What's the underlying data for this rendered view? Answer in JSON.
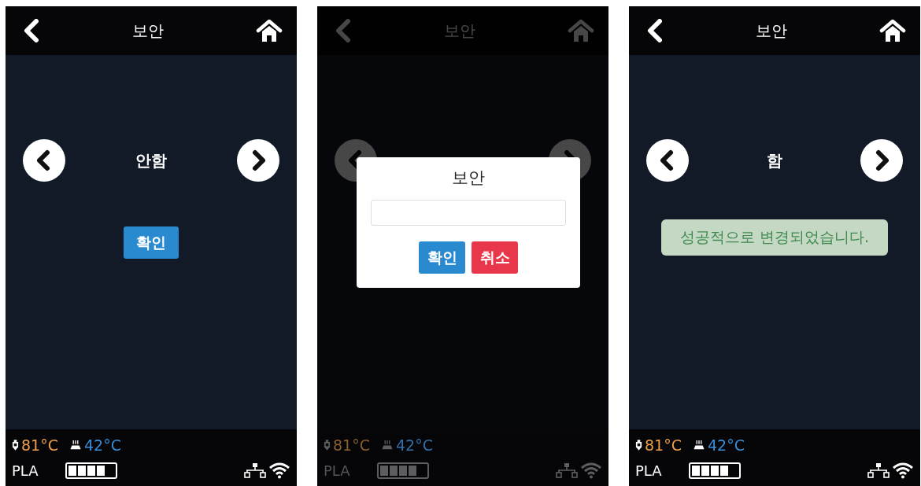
{
  "screens": [
    {
      "title": "보안",
      "dimmed": false,
      "option": "안함",
      "confirm_button": "확인",
      "temps": [
        {
          "kind": "nozzle",
          "value": "81°C",
          "color": "#f0a04b"
        },
        {
          "kind": "bed",
          "value": "42°C",
          "color": "#3a8fd8"
        }
      ],
      "material": "PLA",
      "battery": {
        "level": 0.8
      }
    },
    {
      "title": "보안",
      "dimmed": true,
      "temps": [
        {
          "kind": "nozzle",
          "value": "81°C",
          "color": "#8a6030"
        },
        {
          "kind": "bed",
          "value": "42°C",
          "color": "#3470a8"
        }
      ],
      "material": "PLA",
      "battery": {
        "level": 0.8
      },
      "dialog": {
        "title": "보안",
        "buttons": [
          {
            "label": "확인",
            "kind": "primary"
          },
          {
            "label": "취소",
            "kind": "danger"
          }
        ]
      }
    },
    {
      "title": "보안",
      "dimmed": false,
      "option": "함",
      "toast": "성공적으로 변경되었습니다.",
      "temps": [
        {
          "kind": "nozzle",
          "value": "81°C",
          "color": "#f0a04b"
        },
        {
          "kind": "bed",
          "value": "42°C",
          "color": "#3a8fd8"
        }
      ],
      "material": "PLA",
      "battery": {
        "level": 0.8
      }
    }
  ]
}
